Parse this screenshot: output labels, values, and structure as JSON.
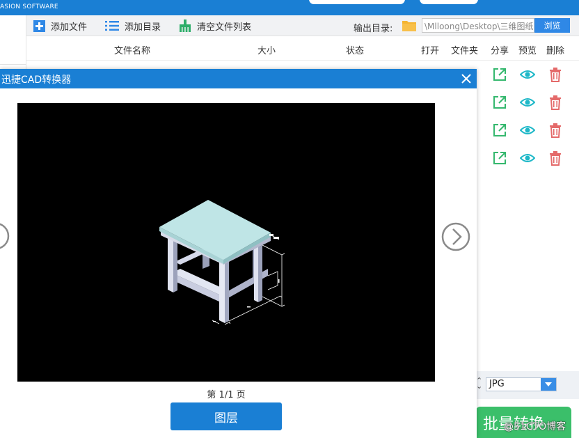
{
  "app": {
    "brand": "ASION SOFTWARE"
  },
  "toolbar": {
    "add_file": "添加文件",
    "add_dir": "添加目录",
    "clear_list": "清空文件列表",
    "output_label": "输出目录:",
    "output_path": "\\Mlloong\\Desktop\\三维图纸",
    "browse": "浏览"
  },
  "table": {
    "headers": {
      "filename": "文件名称",
      "size": "大小",
      "status": "状态",
      "open": "打开",
      "folder": "文件夹",
      "share": "分享",
      "preview": "预览",
      "delete": "删除"
    },
    "row_count": 4
  },
  "bottom": {
    "format_value": "JPG",
    "convert_label": "批量转换",
    "watermark": "@51CTO博客"
  },
  "modal": {
    "title": "迅捷CAD转换器",
    "page_indicator": "第 1/1 页",
    "layer_button": "图层"
  },
  "icons": {
    "add_file": "plus-icon",
    "add_dir": "list-icon",
    "clear_list": "broom-icon",
    "folder": "folder-icon",
    "share": "share-icon",
    "preview": "eye-icon",
    "delete": "trash-icon",
    "close": "close-icon",
    "prev": "chevron-left-icon",
    "next": "chevron-right-icon"
  },
  "colors": {
    "primary": "#1a7fd4",
    "accent_button": "#2f88e6",
    "share": "#35b86e",
    "preview": "#1fb8c8",
    "delete": "#e46a6a",
    "convert": "#3bbf6a",
    "table_top": "#bfe5e6"
  }
}
